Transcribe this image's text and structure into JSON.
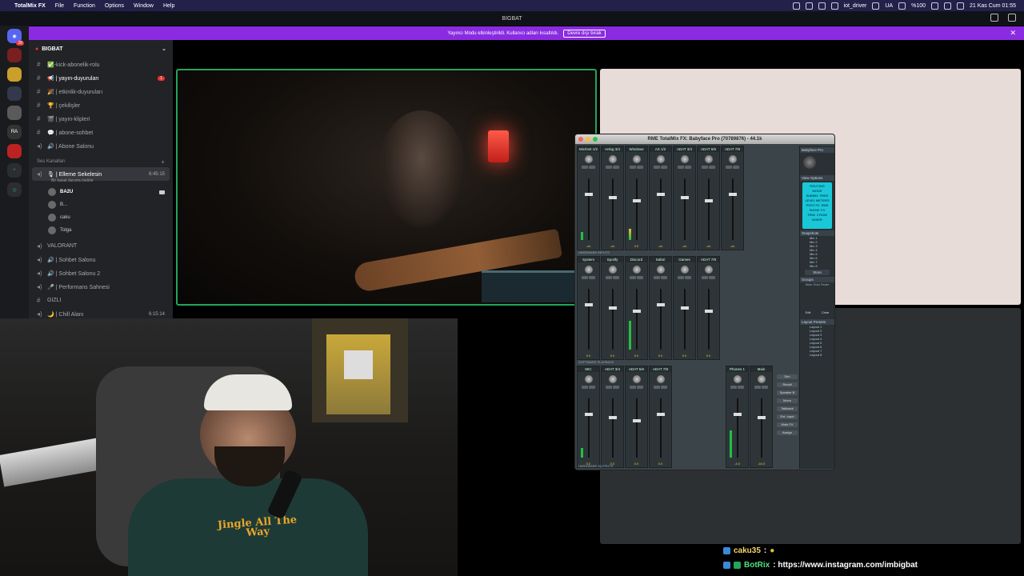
{
  "menubar": {
    "app": "TotalMix FX",
    "items": [
      "File",
      "Function",
      "Options",
      "Window",
      "Help"
    ],
    "user": "iot_driver",
    "lang": "UA",
    "battery": "%100",
    "datetime": "21 Kas Cum 01:55"
  },
  "window": {
    "title": "BIGBAT"
  },
  "banner": {
    "text": "Yayıncı Modu etkinleştirildi. Kullanıcı adları kısaltıldı.",
    "button": "Devre dışı bırak"
  },
  "rail": {
    "items": [
      "BIGBAT",
      "RA"
    ],
    "badge": "28"
  },
  "server": {
    "name": "BIGBAT"
  },
  "channels": [
    {
      "name": "✅-kick-abonelik-rolu"
    },
    {
      "name": "📢 | yayın-duyuruları",
      "unread": "1"
    },
    {
      "name": "🎉 | etkinlik-duyuruları"
    },
    {
      "name": "🏆 | çekilişler"
    },
    {
      "name": "🎬 | yayın-klipleri"
    },
    {
      "name": "💬 | abone-sohbet"
    },
    {
      "name": "🔊 | Abone Salonu"
    }
  ],
  "voice": {
    "category": "Ses Kanalları",
    "selected": {
      "name": "🎙 | Elleme Sekelesin",
      "time": "6:45:15",
      "sub": "Bir kanal durumu belirle"
    },
    "users": [
      "BA2U",
      "B...",
      "caku",
      "Tolga"
    ],
    "others": [
      {
        "name": "VALORANT"
      },
      {
        "name": "🔊 | Sohbet Salonu"
      },
      {
        "name": "🔊 | Sohbet Salonu 2"
      },
      {
        "name": "🎤 | Performans Sahnesi"
      },
      {
        "name": "GIZLI"
      },
      {
        "name": "🌙 | Chill Alanı",
        "time": "6:15:14"
      }
    ]
  },
  "totalmix": {
    "title": "RME TotalMix FX: Babyface Pro (70789876) - 44.1k",
    "inputs": [
      {
        "name": "Mic/Inst 1/2",
        "val": "-oo"
      },
      {
        "name": "Anlog 3/4",
        "val": "-oo"
      },
      {
        "name": "Windows",
        "val": "0.0"
      },
      {
        "name": "AS 1/2",
        "val": "-oo"
      },
      {
        "name": "ADAT 3/4",
        "val": "-oo"
      },
      {
        "name": "ADAT 5/6",
        "val": "-oo"
      },
      {
        "name": "ADAT 7/8",
        "val": "-oo"
      }
    ],
    "inputs_label": "HARDWARE INPUTS",
    "playback": [
      {
        "name": "System",
        "val": "0.0"
      },
      {
        "name": "Spotify",
        "val": "0.0"
      },
      {
        "name": "Discord",
        "val": "0.0"
      },
      {
        "name": "Safari",
        "val": "0.0"
      },
      {
        "name": "Games",
        "val": "0.0"
      },
      {
        "name": "ADAT 7/8",
        "val": "0.0"
      }
    ],
    "playback_label": "SOFTWARE PLAYBACK",
    "outputs": [
      {
        "name": "MIC",
        "val": "0.0"
      },
      {
        "name": "ADAT 3/4",
        "val": "0.0"
      },
      {
        "name": "ADAT 5/6",
        "val": "0.0"
      },
      {
        "name": "ADAT 7/8",
        "val": "0.0"
      }
    ],
    "outputs_label": "HARDWARE OUTPUTS",
    "monitor": [
      {
        "name": "Phones 1",
        "val": "-4.0"
      },
      {
        "name": "Main",
        "val": "-16.5"
      }
    ],
    "monitor_buttons": [
      "Dim",
      "Recall",
      "Speaker B",
      "Mono",
      "Talkback",
      "Ext. Input",
      "Mute FX",
      "Assign"
    ],
    "side": {
      "device": "Babyface Pro",
      "view_options": "View Options",
      "routing": [
        "ROUTING MODE",
        "SUBMIX",
        "FREE",
        "LEVEL METERS",
        "POST FX",
        "RMS",
        "SHOW",
        "FX",
        "TRIM",
        "2 ROW",
        "MIXER"
      ],
      "snapshots": "Snapshots",
      "mixes": [
        "Mix 1",
        "Mix 2",
        "Mix 3",
        "Mix 4",
        "Mix 5",
        "Mix 6",
        "Mix 7",
        "Mix 8"
      ],
      "store": "Store",
      "groups": "Groups",
      "groups_cols": "Mute Solo Fader",
      "edit": "Edit",
      "clear": "Clear",
      "layout": "Layout Presets",
      "layouts": [
        "Layout 1",
        "Layout 2",
        "Layout 3",
        "Layout 4",
        "Layout 5",
        "Layout 6",
        "Layout 7",
        "Layout 8"
      ]
    }
  },
  "chat": [
    {
      "name": "caku35",
      "text": ":"
    },
    {
      "name": "BotRix",
      "text": ": https://www.instagram.com/imbigbat"
    }
  ],
  "shirt_text": "Jingle All The Way"
}
